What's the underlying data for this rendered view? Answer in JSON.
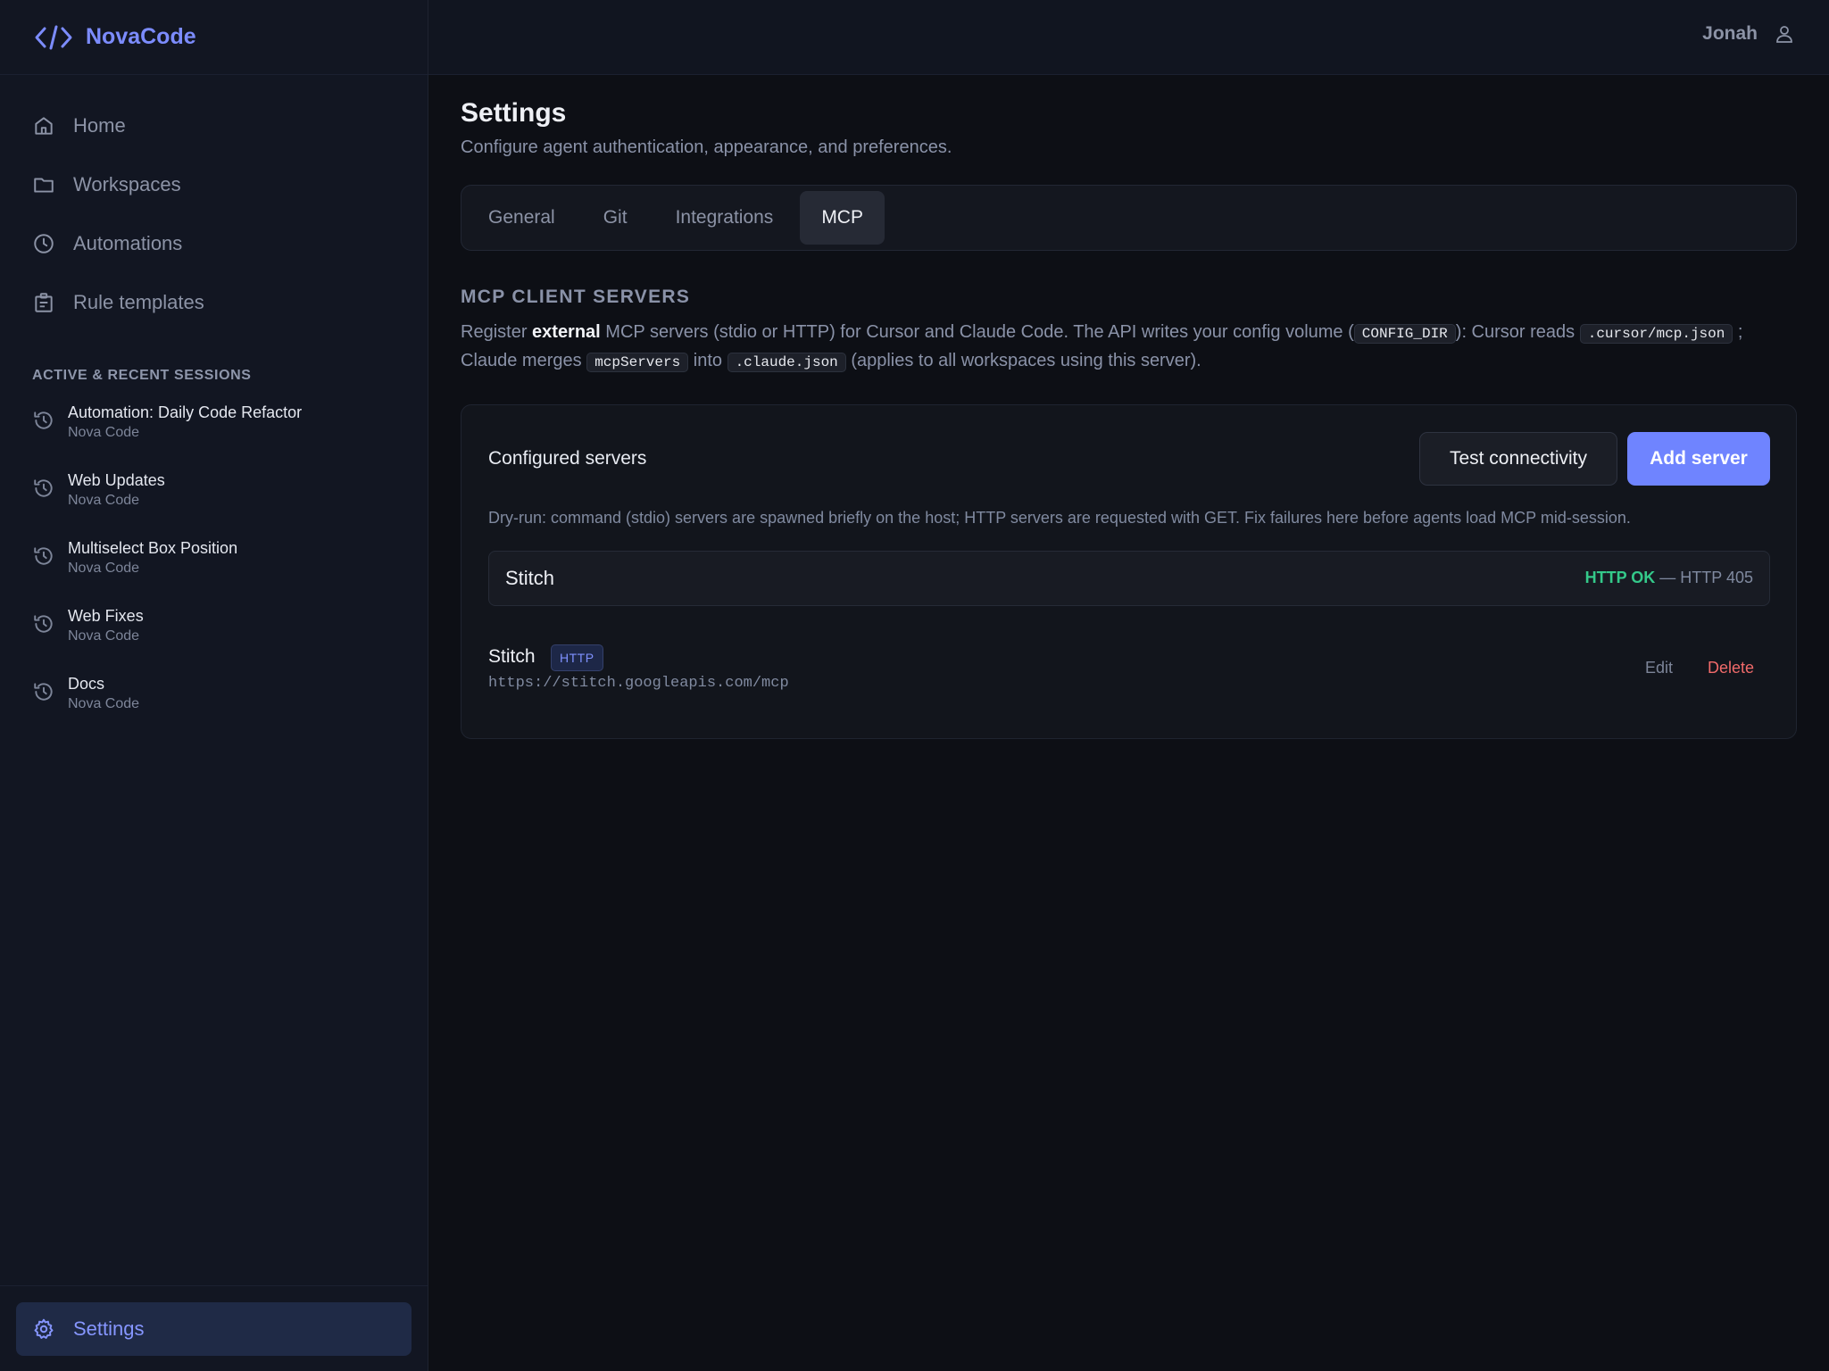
{
  "brand": {
    "name": "NovaCode"
  },
  "user": {
    "name": "Jonah"
  },
  "sidebar": {
    "nav": [
      {
        "label": "Home",
        "icon": "home-icon"
      },
      {
        "label": "Workspaces",
        "icon": "folder-icon"
      },
      {
        "label": "Automations",
        "icon": "clock-icon"
      },
      {
        "label": "Rule templates",
        "icon": "clipboard-icon"
      }
    ],
    "sessions_label": "ACTIVE & RECENT SESSIONS",
    "sessions": [
      {
        "title": "Automation: Daily Code Refactor",
        "workspace": "Nova Code"
      },
      {
        "title": "Web Updates",
        "workspace": "Nova Code"
      },
      {
        "title": "Multiselect Box Position",
        "workspace": "Nova Code"
      },
      {
        "title": "Web Fixes",
        "workspace": "Nova Code"
      },
      {
        "title": "Docs",
        "workspace": "Nova Code"
      }
    ],
    "settings_label": "Settings"
  },
  "page": {
    "title": "Settings",
    "subtitle": "Configure agent authentication, appearance, and preferences."
  },
  "tabs": [
    {
      "label": "General",
      "active": false
    },
    {
      "label": "Git",
      "active": false
    },
    {
      "label": "Integrations",
      "active": false
    },
    {
      "label": "MCP",
      "active": true
    }
  ],
  "mcp": {
    "heading": "MCP CLIENT SERVERS",
    "desc": {
      "p1": "Register ",
      "strong": "external",
      "p2": " MCP servers (stdio or HTTP) for Cursor and Claude Code. The API writes your config volume (",
      "code1": "CONFIG_DIR",
      "p3": "): Cursor reads ",
      "code2": ".cursor/mcp.json",
      "p4": " ; Claude merges ",
      "code3": "mcpServers",
      "p5": " into ",
      "code4": ".claude.json",
      "p6": " (applies to all workspaces using this server)."
    },
    "card": {
      "title": "Configured servers",
      "test_button": "Test connectivity",
      "add_button": "Add server",
      "dryrun_note": "Dry-run: command (stdio) servers are spawned briefly on the host; HTTP servers are requested with GET. Fix failures here before agents load MCP mid-session.",
      "result": {
        "name": "Stitch",
        "status_ok": "HTTP OK",
        "status_detail": " — HTTP 405"
      },
      "server": {
        "name": "Stitch",
        "type": "HTTP",
        "url": "https://stitch.googleapis.com/mcp",
        "edit_label": "Edit",
        "delete_label": "Delete"
      }
    }
  },
  "colors": {
    "accent": "#6f84ff",
    "ok": "#34c98a",
    "danger": "#f06a6a",
    "background": "#0d0f15",
    "sidebar": "#121622"
  }
}
